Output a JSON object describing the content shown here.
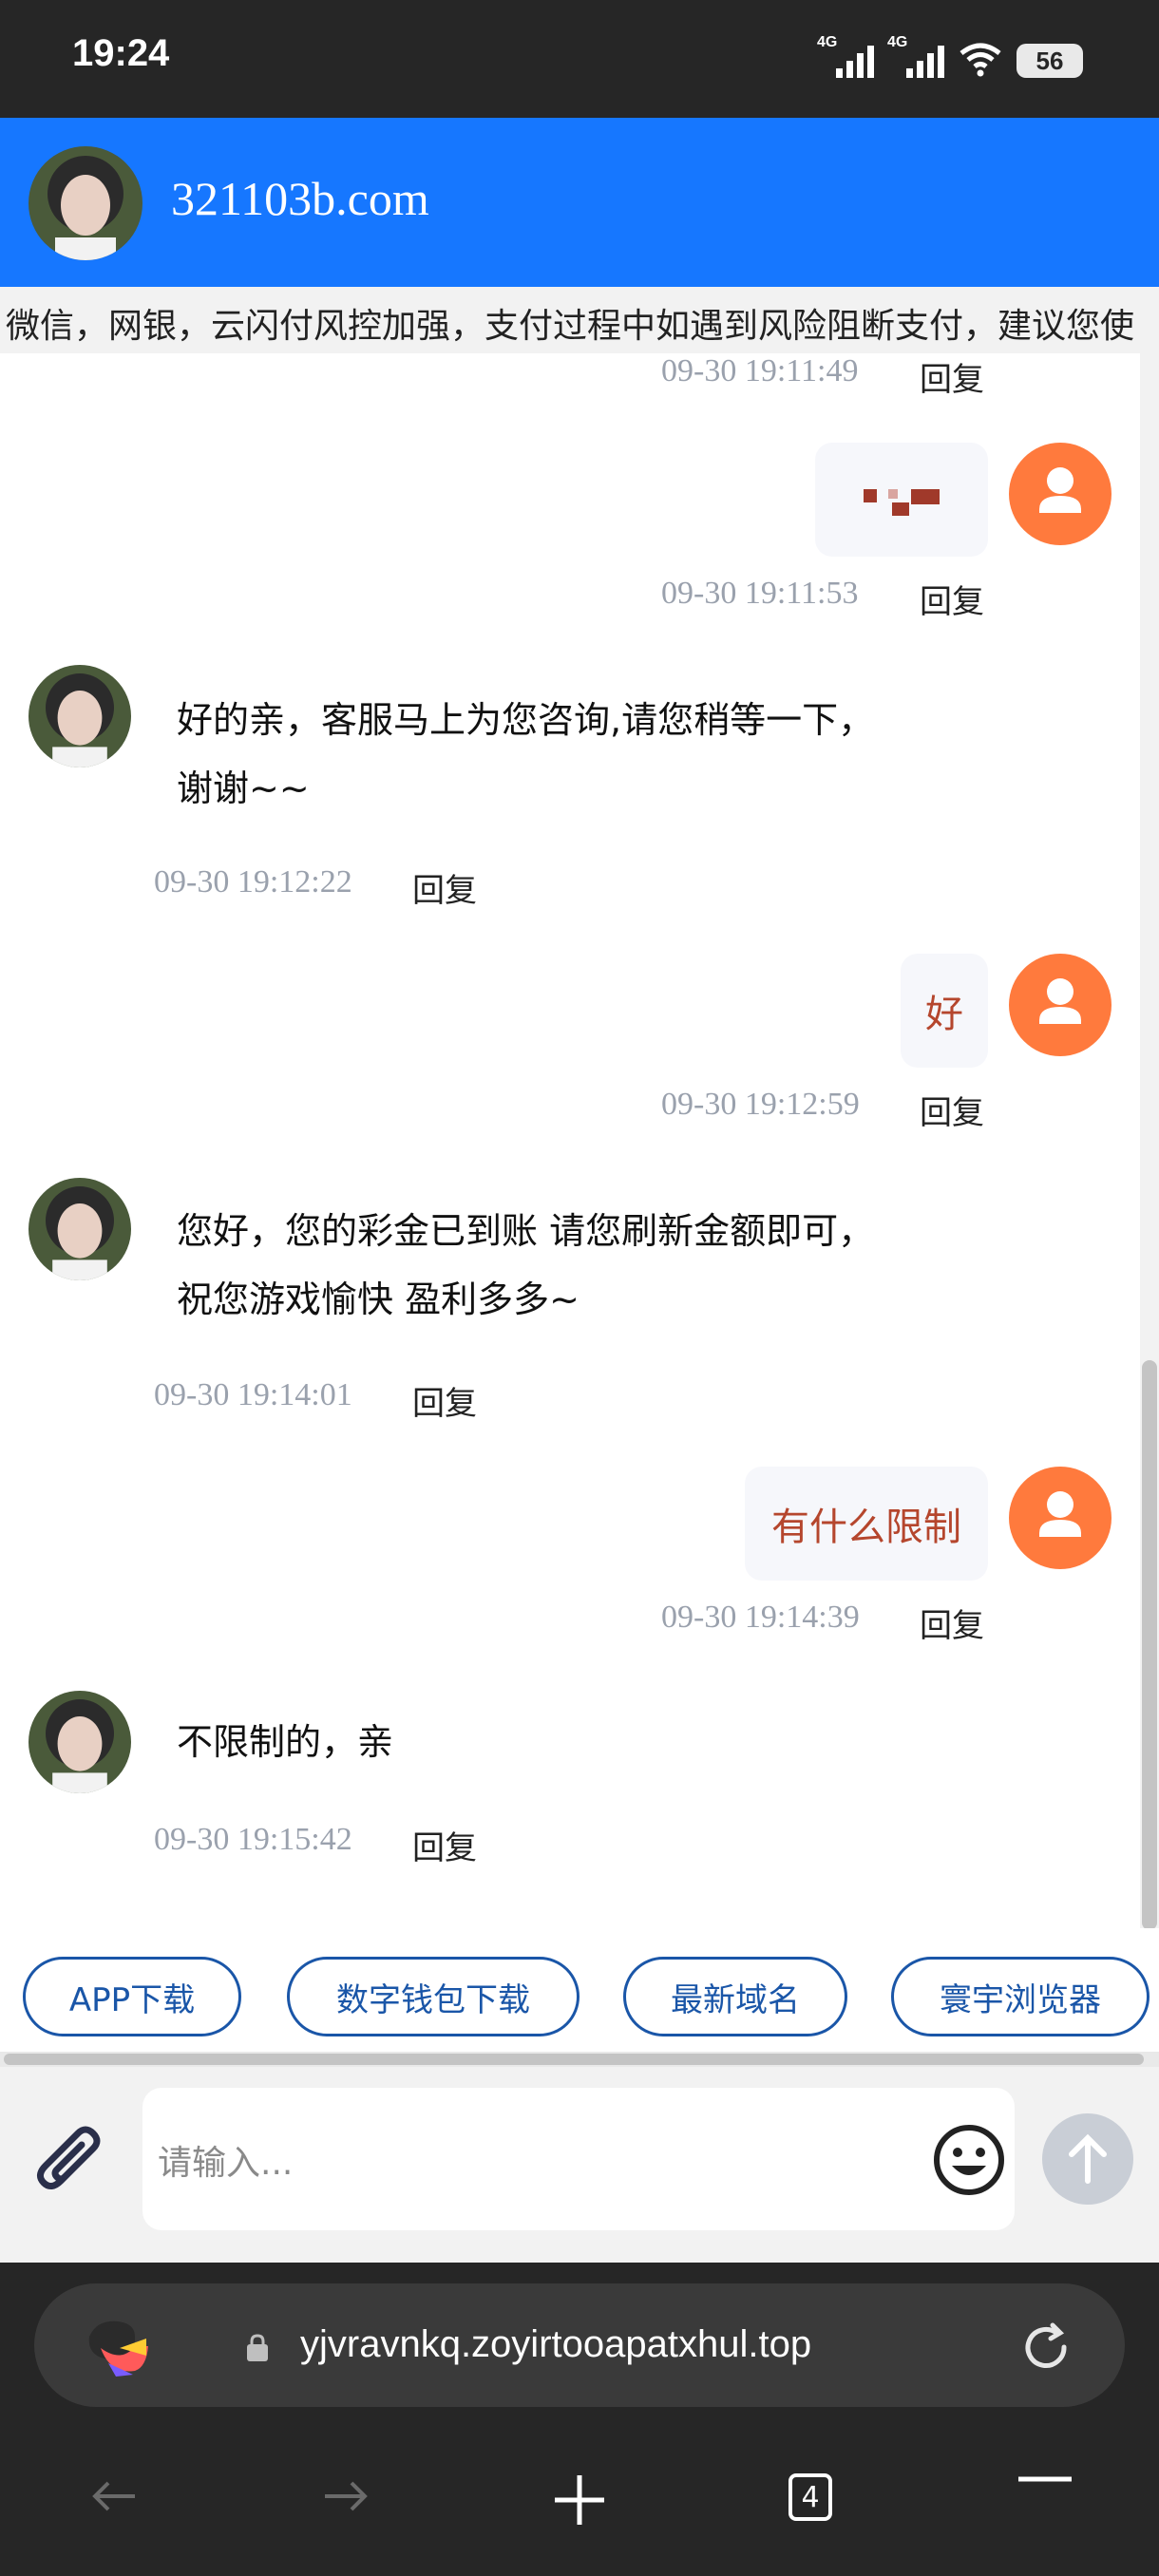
{
  "status_bar": {
    "time": "19:24",
    "network_1": "4G",
    "network_2": "4G",
    "battery": "56"
  },
  "header": {
    "title": "321103b.com"
  },
  "notice": {
    "text": "微信，网银，云闪付风控加强，支付过程中如遇到风险阻断支付，建议您使"
  },
  "messages": [
    {
      "side": "user",
      "time": "09-30 19:11:49",
      "reply": "回复"
    },
    {
      "side": "user",
      "time": "09-30 19:11:53",
      "reply": "回复"
    },
    {
      "side": "agent",
      "line1": "好的亲，客服马上为您咨询,请您稍等一下，",
      "line2": "谢谢~~",
      "time": "09-30 19:12:22",
      "reply": "回复"
    },
    {
      "side": "user",
      "text": "好",
      "time": "09-30 19:12:59",
      "reply": "回复"
    },
    {
      "side": "agent",
      "line1": "您好，您的彩金已到账 请您刷新金额即可，",
      "line2": "祝您游戏愉快 盈利多多~",
      "time": "09-30 19:14:01",
      "reply": "回复"
    },
    {
      "side": "user",
      "text": "有什么限制",
      "time": "09-30 19:14:39",
      "reply": "回复"
    },
    {
      "side": "agent",
      "line1": "不限制的，亲",
      "time": "09-30 19:15:42",
      "reply": "回复"
    }
  ],
  "quick_links": [
    "APP下载",
    "数字钱包下载",
    "最新域名",
    "寰宇浏览器"
  ],
  "input": {
    "placeholder": "请输入..."
  },
  "browser": {
    "url": "yjvravnkq.zoyirtooapatxhul.top",
    "tab_count": "4"
  },
  "colors": {
    "header_blue": "#1677ff",
    "user_avatar": "#ff7a3d",
    "link_blue": "#1a56a8",
    "user_text": "#b5462d"
  }
}
